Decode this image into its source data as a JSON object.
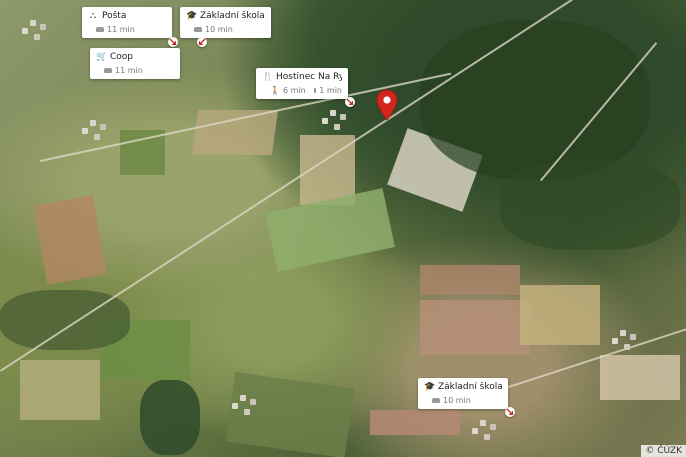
{
  "map": {
    "attribution": "© ČÚZK"
  },
  "places": [
    {
      "id": "posta",
      "icon": "post-office-icon",
      "glyph": "⛬",
      "name": "Pošta",
      "car_time": "11 min"
    },
    {
      "id": "zakladni-skola-ra",
      "icon": "school-icon",
      "glyph": "🎓",
      "name": "Základní škola Ra...",
      "car_time": "10 min"
    },
    {
      "id": "coop",
      "icon": "shopping-cart-icon",
      "glyph": "🛒",
      "name": "Coop",
      "car_time": "11 min"
    },
    {
      "id": "hostinec",
      "icon": "restaurant-icon",
      "glyph": "🍴",
      "name": "Hostinec Na Rych...",
      "walk_time": "6 min",
      "car_time": "1 min"
    },
    {
      "id": "zakladni-skola-lu",
      "icon": "school-icon",
      "glyph": "🎓",
      "name": "Základní škola Lu...",
      "car_time": "10 min"
    }
  ]
}
